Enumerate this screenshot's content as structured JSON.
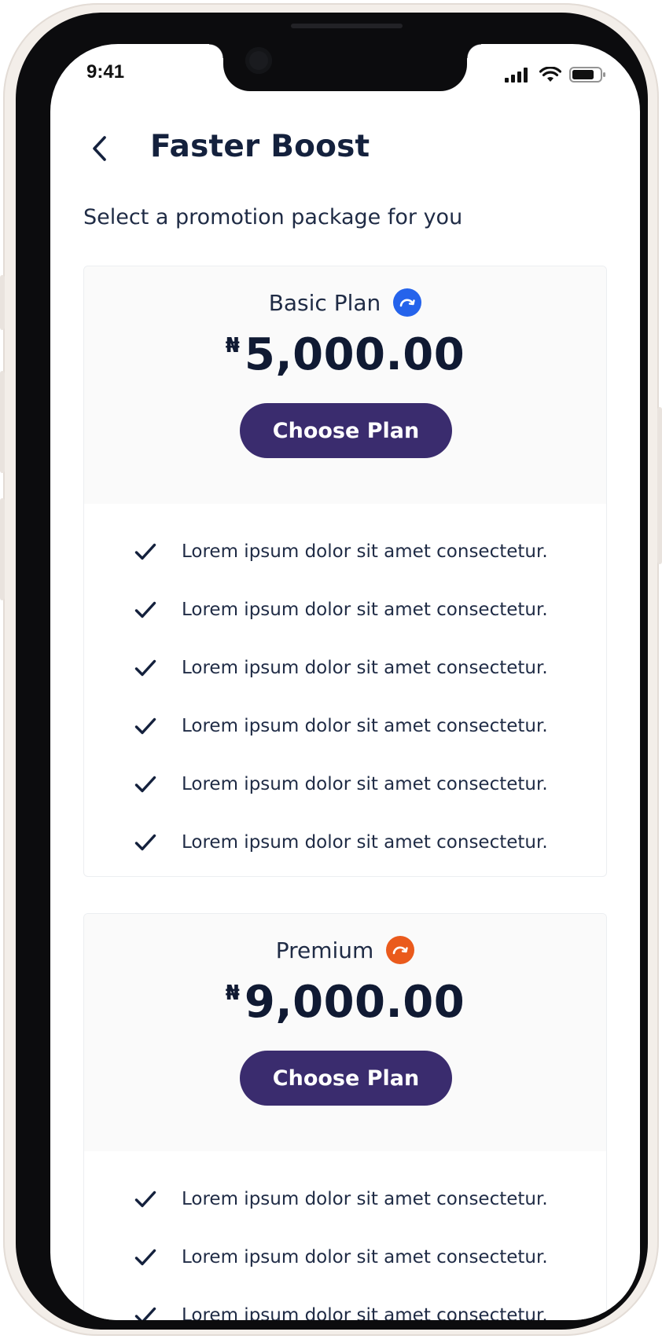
{
  "status_bar": {
    "time": "9:41",
    "icons": [
      "signal-icon",
      "wifi-icon",
      "battery-icon"
    ]
  },
  "header": {
    "back_icon": "chevron-left-icon",
    "title": "Faster Boost"
  },
  "subtitle": "Select a promotion package for you",
  "colors": {
    "primary_button": "#3a2c6e",
    "basic_badge": "#2563eb",
    "premium_badge": "#ea5a1c",
    "text_dark": "#14213d"
  },
  "plans": [
    {
      "name": "Basic Plan",
      "badge_icon": "boost-arrow-icon",
      "currency": "₦",
      "price": "5,000.00",
      "button_label": "Choose Plan",
      "features": [
        "Lorem ipsum dolor sit amet consectetur.",
        "Lorem ipsum dolor sit amet consectetur.",
        "Lorem ipsum dolor sit amet consectetur.",
        "Lorem ipsum dolor sit amet consectetur.",
        "Lorem ipsum dolor sit amet consectetur.",
        "Lorem ipsum dolor sit amet consectetur."
      ]
    },
    {
      "name": "Premium",
      "badge_icon": "boost-arrow-icon",
      "currency": "₦",
      "price": "9,000.00",
      "button_label": "Choose Plan",
      "features": [
        "Lorem ipsum dolor sit amet consectetur.",
        "Lorem ipsum dolor sit amet consectetur.",
        "Lorem ipsum dolor sit amet consectetur."
      ]
    }
  ]
}
